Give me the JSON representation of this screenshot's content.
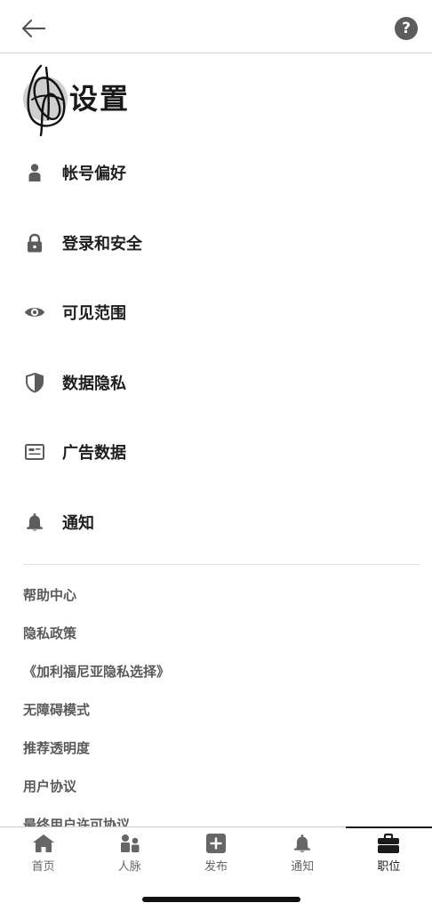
{
  "header": {
    "help_label": "?"
  },
  "title": "设置",
  "menu": [
    {
      "label": "帐号偏好",
      "icon": "person-icon"
    },
    {
      "label": "登录和安全",
      "icon": "lock-icon"
    },
    {
      "label": "可见范围",
      "icon": "eye-icon"
    },
    {
      "label": "数据隐私",
      "icon": "shield-icon"
    },
    {
      "label": "广告数据",
      "icon": "ad-card-icon"
    },
    {
      "label": "通知",
      "icon": "bell-icon"
    }
  ],
  "links": [
    "帮助中心",
    "隐私政策",
    "《加利福尼亚隐私选择》",
    "无障碍模式",
    "推荐透明度",
    "用户协议",
    "最终用户许可协议"
  ],
  "bottom_nav": [
    {
      "label": "首页",
      "icon": "home-icon",
      "active": false
    },
    {
      "label": "人脉",
      "icon": "network-icon",
      "active": false
    },
    {
      "label": "发布",
      "icon": "post-icon",
      "active": false
    },
    {
      "label": "通知",
      "icon": "bell-icon",
      "active": false
    },
    {
      "label": "职位",
      "icon": "briefcase-icon",
      "active": true
    }
  ],
  "colors": {
    "icon_gray": "#5c5c5c",
    "text_dark": "#1a1a1a",
    "link_gray": "#5a5a5a"
  }
}
